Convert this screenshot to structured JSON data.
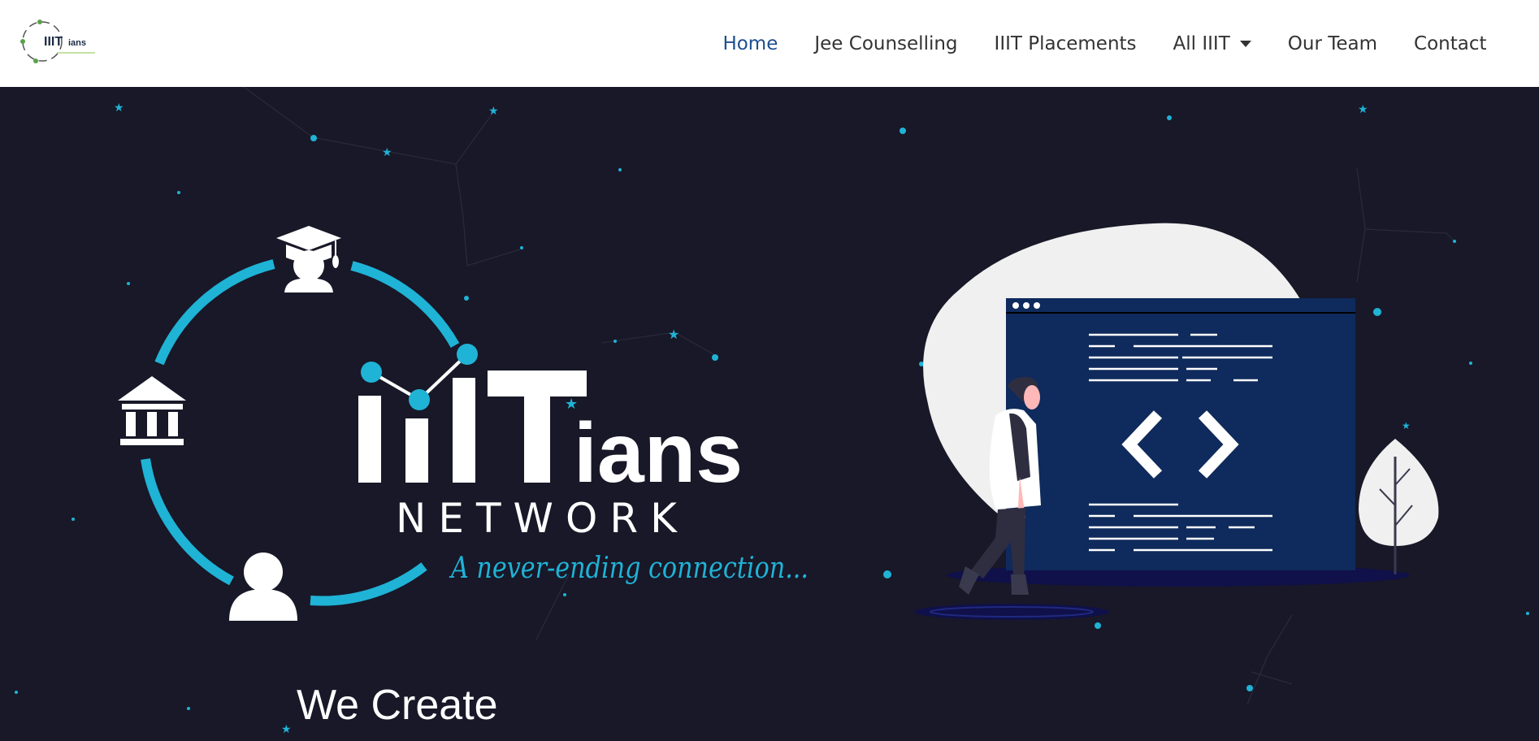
{
  "brand": {
    "logo_text": "IIITians",
    "logo_tagline": "A never-ending connection..."
  },
  "nav": {
    "items": [
      {
        "label": "Home",
        "active": true
      },
      {
        "label": "Jee Counselling",
        "active": false
      },
      {
        "label": "IIIT Placements",
        "active": false
      },
      {
        "label": "All IIIT",
        "active": false,
        "dropdown": true
      },
      {
        "label": "Our Team",
        "active": false
      },
      {
        "label": "Contact",
        "active": false
      }
    ]
  },
  "hero": {
    "logo_wordmark": "IIITians",
    "logo_network": "NETWORK",
    "logo_tagline": "A never-ending connection...",
    "heading": "We Create"
  },
  "colors": {
    "nav_bg": "#ffffff",
    "hero_bg": "#181828",
    "accent_cyan": "#1fb3d6",
    "active_link": "#1d4f91",
    "screen_blue": "#0f2a5c"
  }
}
